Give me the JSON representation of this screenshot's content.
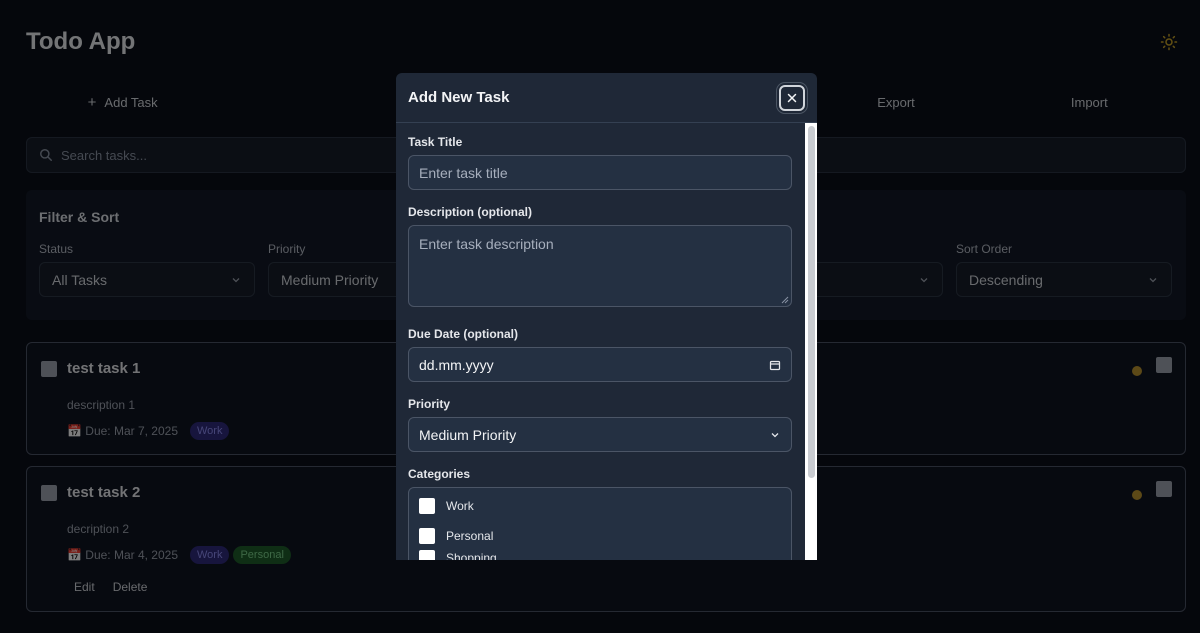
{
  "app": {
    "title": "Todo App"
  },
  "toolbar": {
    "add_task": "Add Task",
    "export": "Export",
    "import": "Import"
  },
  "search": {
    "placeholder": "Search tasks..."
  },
  "filter": {
    "title": "Filter & Sort",
    "status": {
      "label": "Status",
      "value": "All Tasks"
    },
    "priority": {
      "label": "Priority",
      "value": "Medium Priority"
    },
    "sort_order": {
      "label": "Sort Order",
      "value": "Descending"
    }
  },
  "tasks": [
    {
      "title": "test task 1",
      "description": "description 1",
      "due": "📅 Due: Mar 7, 2025",
      "tags": [
        "Work"
      ]
    },
    {
      "title": "test task 2",
      "description": "decription 2",
      "due": "📅 Due: Mar 4, 2025",
      "tags": [
        "Work",
        "Personal"
      ],
      "actions": [
        "Edit",
        "Delete"
      ]
    }
  ],
  "modal": {
    "title": "Add New Task",
    "task_title_label": "Task Title",
    "task_title_placeholder": "Enter task title",
    "description_label": "Description (optional)",
    "description_placeholder": "Enter task description",
    "due_date_label": "Due Date (optional)",
    "due_date_placeholder": "dd.mm.yyyy",
    "priority_label": "Priority",
    "priority_value": "Medium Priority",
    "categories_label": "Categories",
    "categories": [
      "Work",
      "Personal",
      "Shopping"
    ]
  },
  "colors": {
    "background": "#0b0f19",
    "modal": "#1f2837",
    "work_tag": "#2e2a7a",
    "personal_tag": "#1f5c2b",
    "priority_dot": "#b8922e"
  }
}
